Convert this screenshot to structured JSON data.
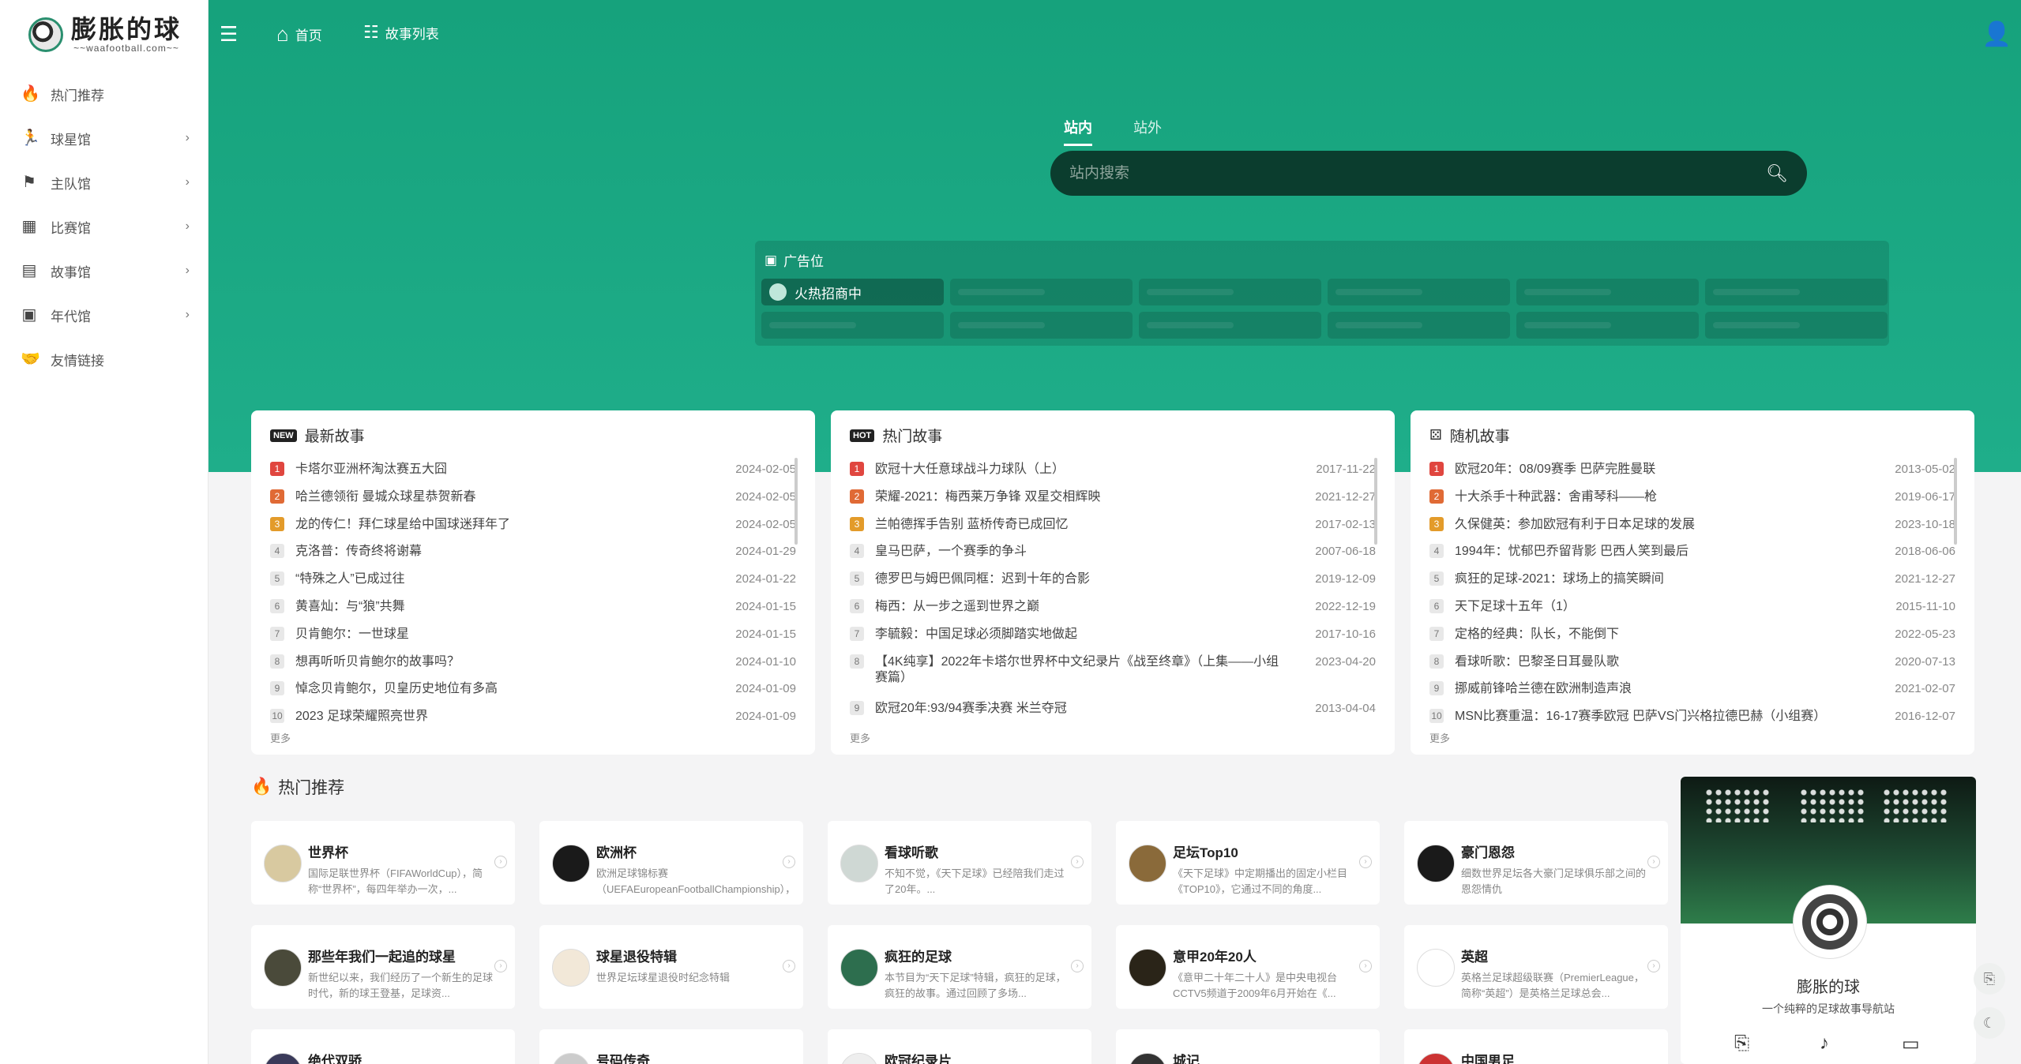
{
  "logo": {
    "title": "膨胀的球",
    "subtitle": "~~waafootball.com~~"
  },
  "sidebar": {
    "items": [
      {
        "label": "热门推荐",
        "icon": "fire-icon",
        "glyph": "🔥",
        "chevron": false
      },
      {
        "label": "球星馆",
        "icon": "player-icon",
        "glyph": "🏃",
        "chevron": true
      },
      {
        "label": "主队馆",
        "icon": "flag-icon",
        "glyph": "⚑",
        "chevron": true
      },
      {
        "label": "比赛馆",
        "icon": "scoreboard-icon",
        "glyph": "▦",
        "chevron": true
      },
      {
        "label": "故事馆",
        "icon": "book-icon",
        "glyph": "▤",
        "chevron": true
      },
      {
        "label": "年代馆",
        "icon": "calendar-icon",
        "glyph": "▣",
        "chevron": true
      },
      {
        "label": "友情链接",
        "icon": "handshake-icon",
        "glyph": "🤝",
        "chevron": false
      }
    ]
  },
  "topbar": {
    "home": "首页",
    "story_list": "故事列表"
  },
  "search": {
    "tab_inner": "站内",
    "tab_outer": "站外",
    "placeholder": "站内搜索"
  },
  "ad": {
    "title": "广告位",
    "first": "火热招商中"
  },
  "panels": [
    {
      "title": "最新故事",
      "badge": "NEW",
      "more": "更多",
      "items": [
        {
          "t": "卡塔尔亚洲杯淘汰赛五大囧",
          "d": "2024-02-05"
        },
        {
          "t": "哈兰德领衔 曼城众球星恭贺新春",
          "d": "2024-02-05"
        },
        {
          "t": "龙的传仁！拜仁球星给中国球迷拜年了",
          "d": "2024-02-05"
        },
        {
          "t": "克洛普：传奇终将谢幕",
          "d": "2024-01-29"
        },
        {
          "t": "“特殊之人”已成过往",
          "d": "2024-01-22"
        },
        {
          "t": "黄喜灿：与“狼”共舞",
          "d": "2024-01-15"
        },
        {
          "t": "贝肯鲍尔：一世球星",
          "d": "2024-01-15"
        },
        {
          "t": "想再听听贝肯鲍尔的故事吗？",
          "d": "2024-01-10"
        },
        {
          "t": "悼念贝肯鲍尔，贝皇历史地位有多高",
          "d": "2024-01-09"
        },
        {
          "t": "2023 足球荣耀照亮世界",
          "d": "2024-01-09"
        }
      ]
    },
    {
      "title": "热门故事",
      "badge": "HOT",
      "more": "更多",
      "items": [
        {
          "t": "欧冠十大任意球战斗力球队（上）",
          "d": "2017-11-22"
        },
        {
          "t": "荣耀-2021：梅西莱万争锋 双星交相辉映",
          "d": "2021-12-27"
        },
        {
          "t": "兰帕德挥手告别 蓝桥传奇已成回忆",
          "d": "2017-02-13"
        },
        {
          "t": "皇马巴萨，一个赛季的争斗",
          "d": "2007-06-18"
        },
        {
          "t": "德罗巴与姆巴佩同框：迟到十年的合影",
          "d": "2019-12-09"
        },
        {
          "t": "梅西：从一步之遥到世界之巅",
          "d": "2022-12-19"
        },
        {
          "t": "李毓毅：中国足球必须脚踏实地做起",
          "d": "2017-10-16"
        },
        {
          "t": "【4K纯享】2022年卡塔尔世界杯中文纪录片《战至终章》（上集——小组赛篇）",
          "d": "2023-04-20"
        },
        {
          "t": "欧冠20年:93/94赛季决赛 米兰夺冠",
          "d": "2013-04-04"
        }
      ]
    },
    {
      "title": "随机故事",
      "badge": "",
      "more": "更多",
      "items": [
        {
          "t": "欧冠20年：08/09赛季 巴萨完胜曼联",
          "d": "2013-05-02"
        },
        {
          "t": "十大杀手十种武器：舍甫琴科——枪",
          "d": "2019-06-17"
        },
        {
          "t": "久保健英：参加欧冠有利于日本足球的发展",
          "d": "2023-10-18"
        },
        {
          "t": "1994年：忧郁巴乔留背影 巴西人笑到最后",
          "d": "2018-06-06"
        },
        {
          "t": "疯狂的足球-2021：球场上的搞笑瞬间",
          "d": "2021-12-27"
        },
        {
          "t": "天下足球十五年（1）",
          "d": "2015-11-10"
        },
        {
          "t": "定格的经典：队长，不能倒下",
          "d": "2022-05-23"
        },
        {
          "t": "看球听歌：巴黎圣日耳曼队歌",
          "d": "2020-07-13"
        },
        {
          "t": "挪威前锋哈兰德在欧洲制造声浪",
          "d": "2021-02-07"
        },
        {
          "t": "MSN比赛重温：16-17赛季欧冠 巴萨VS门兴格拉德巴赫（小组赛）",
          "d": "2016-12-07"
        }
      ]
    }
  ],
  "hot": {
    "title": "热门推荐",
    "cards": [
      {
        "name": "世界杯",
        "desc": "国际足联世界杯（FIFAWorldCup），简称“世界杯”，每四年举办一次，..."
      },
      {
        "name": "欧洲杯",
        "desc": "欧洲足球锦标赛（UEFAEuropeanFootballChampionship），简称“欧锦..."
      },
      {
        "name": "看球听歌",
        "desc": "不知不觉，《天下足球》已经陪我们走过了20年。..."
      },
      {
        "name": "足坛Top10",
        "desc": "《天下足球》中定期播出的固定小栏目《TOP10》，它通过不同的角度..."
      },
      {
        "name": "豪门恩怨",
        "desc": "细数世界足坛各大豪门足球俱乐部之间的恩怨情仇"
      },
      {
        "name": "那些年我们一起追的球星",
        "desc": "新世纪以来，我们经历了一个新生的足球时代，新的球王登基，足球资..."
      },
      {
        "name": "球星退役特辑",
        "desc": "世界足坛球星退役时纪念特辑"
      },
      {
        "name": "疯狂的足球",
        "desc": "本节目为“天下足球”特辑，疯狂的足球，疯狂的故事。通过回顾了多场..."
      },
      {
        "name": "意甲20年20人",
        "desc": "《意甲二十年二十人》是中央电视台CCTV5频道于2009年6月开始在《..."
      },
      {
        "name": "英超",
        "desc": "英格兰足球超级联赛（PremierLeague，简称“英超”）是英格兰足球总会..."
      },
      {
        "name": "绝代双骄",
        "desc": ""
      },
      {
        "name": "号码传奇",
        "desc": ""
      },
      {
        "name": "欧冠纪录片",
        "desc": ""
      },
      {
        "name": "城记",
        "desc": ""
      },
      {
        "name": "中国男足",
        "desc": ""
      }
    ]
  },
  "profile": {
    "name": "膨胀的球",
    "slogan": "一个纯粹的足球故事导航站"
  },
  "colors": {
    "accent": "#1aa882",
    "search_bg": "#0b3d2e"
  }
}
